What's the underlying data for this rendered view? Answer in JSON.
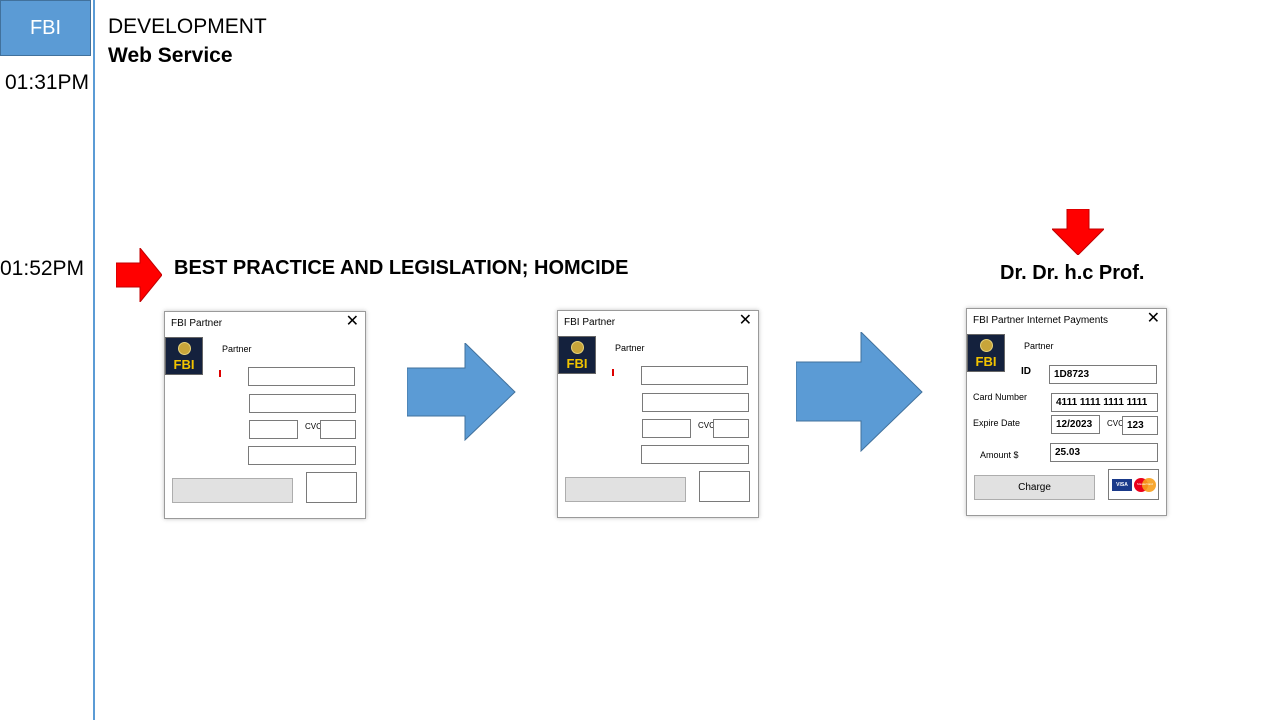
{
  "sidebar": {
    "tag": "FBI"
  },
  "header": {
    "line1": "DEVELOPMENT",
    "line2": "Web Service"
  },
  "times": {
    "t1": "01:31PM",
    "t2": "01:52PM"
  },
  "headings": {
    "left": "BEST PRACTICE AND LEGISLATION;  HOMCIDE",
    "right": "Dr. Dr. h.c  Prof."
  },
  "window1": {
    "title": "FBI Partner",
    "partner_label": "Partner",
    "cvc_label": "CVC",
    "logo_text": "FBI"
  },
  "window2": {
    "title": "FBI Partner",
    "partner_label": "Partner",
    "cvc_label": "CVC",
    "logo_text": "FBI"
  },
  "window3": {
    "title": "FBI Partner Internet Payments",
    "partner_label": "Partner",
    "logo_text": "FBI",
    "id_label": "ID",
    "id_value": "1D8723",
    "card_label": "Card Number",
    "card_value": "4111 1111 1111 1111",
    "expire_label": "Expire Date",
    "expire_value": "12/2023",
    "cvc_label": "CVC",
    "cvc_value": "123",
    "amount_label": "Amount $",
    "amount_value": "25.03",
    "charge_label": "Charge",
    "visa_label": "VISA",
    "mastercard_label": "MasterCard"
  },
  "colors": {
    "accent": "#5b9bd5",
    "arrow_red": "#ff0000",
    "logo_bg": "#14213d",
    "logo_text": "#f2c300"
  }
}
